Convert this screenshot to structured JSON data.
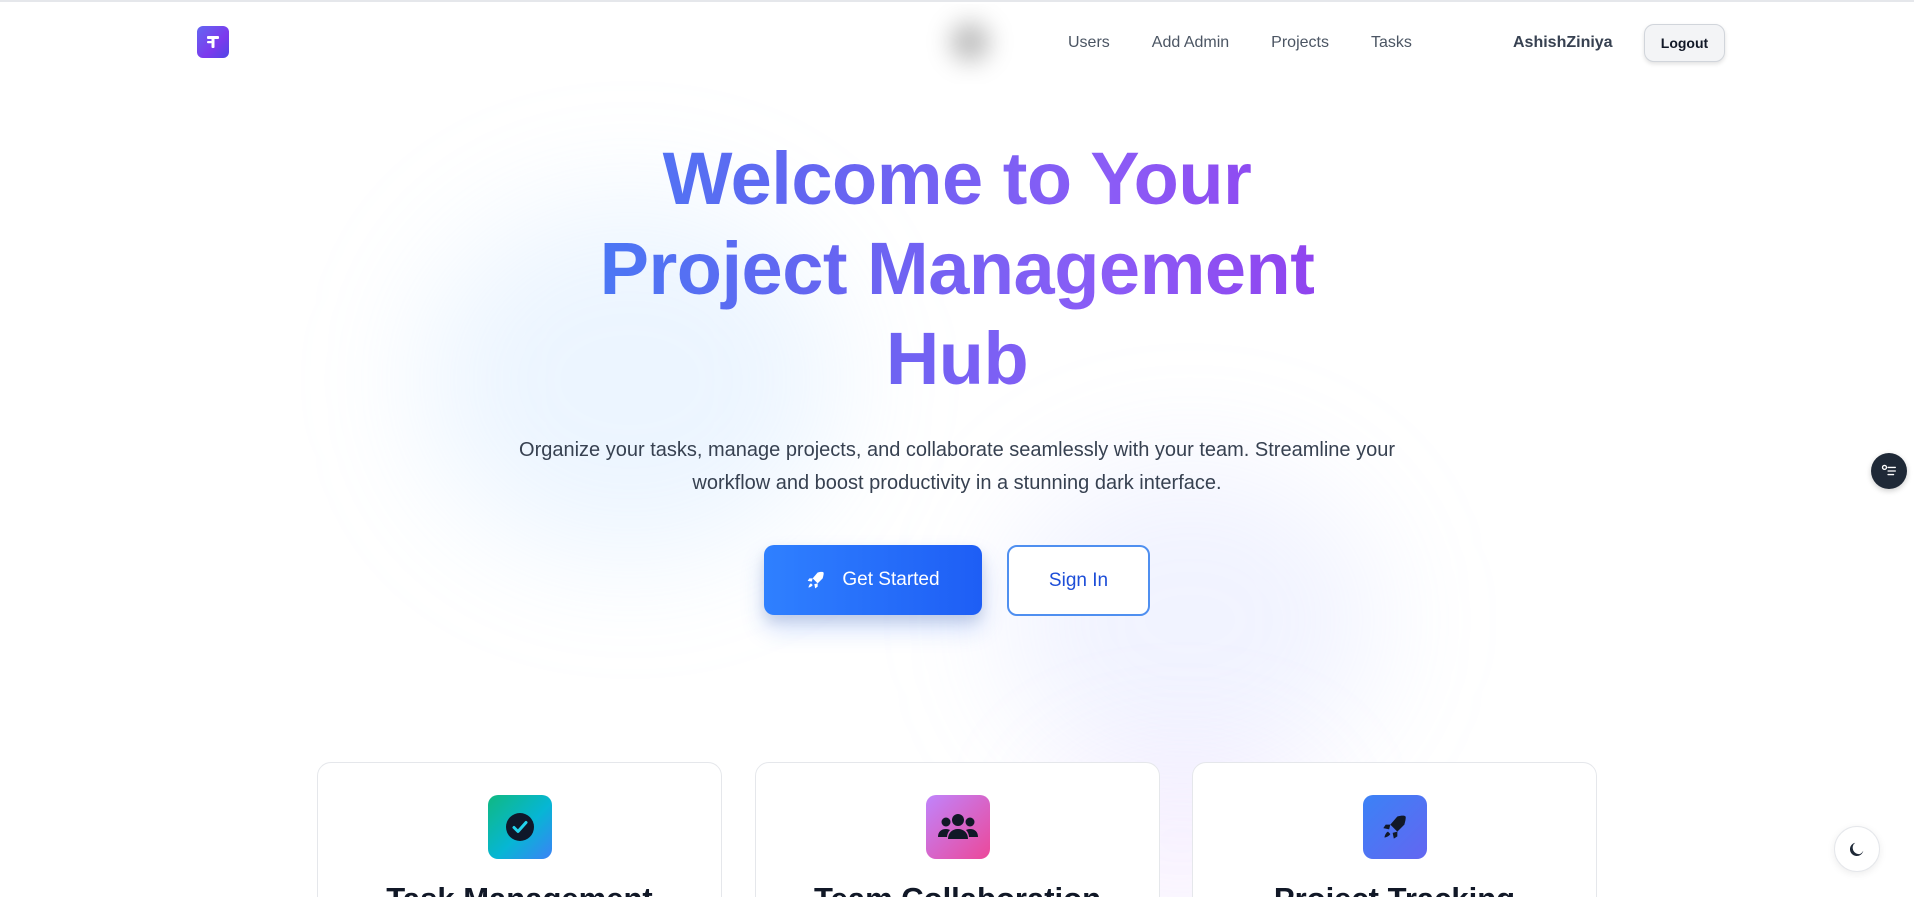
{
  "nav": {
    "links": [
      "Users",
      "Add Admin",
      "Projects",
      "Tasks"
    ],
    "username": "AshishZiniya",
    "logout_label": "Logout"
  },
  "hero": {
    "title_lines": [
      "Welcome to Your",
      "Project Management",
      "Hub"
    ],
    "subtitle": "Organize your tasks, manage projects, and collaborate seamlessly with your team. Streamline your workflow and boost productivity in a stunning dark interface.",
    "primary_button": "Get Started",
    "secondary_button": "Sign In"
  },
  "features": [
    {
      "title": "Task Management",
      "icon": "check-circle-icon"
    },
    {
      "title": "Team Collaboration",
      "icon": "users-icon"
    },
    {
      "title": "Project Tracking",
      "icon": "rocket-icon"
    }
  ],
  "colors": {
    "brand_gradient_start": "#3b82f6",
    "brand_gradient_end": "#9333ea",
    "primary_button": "#1e5ef5"
  }
}
